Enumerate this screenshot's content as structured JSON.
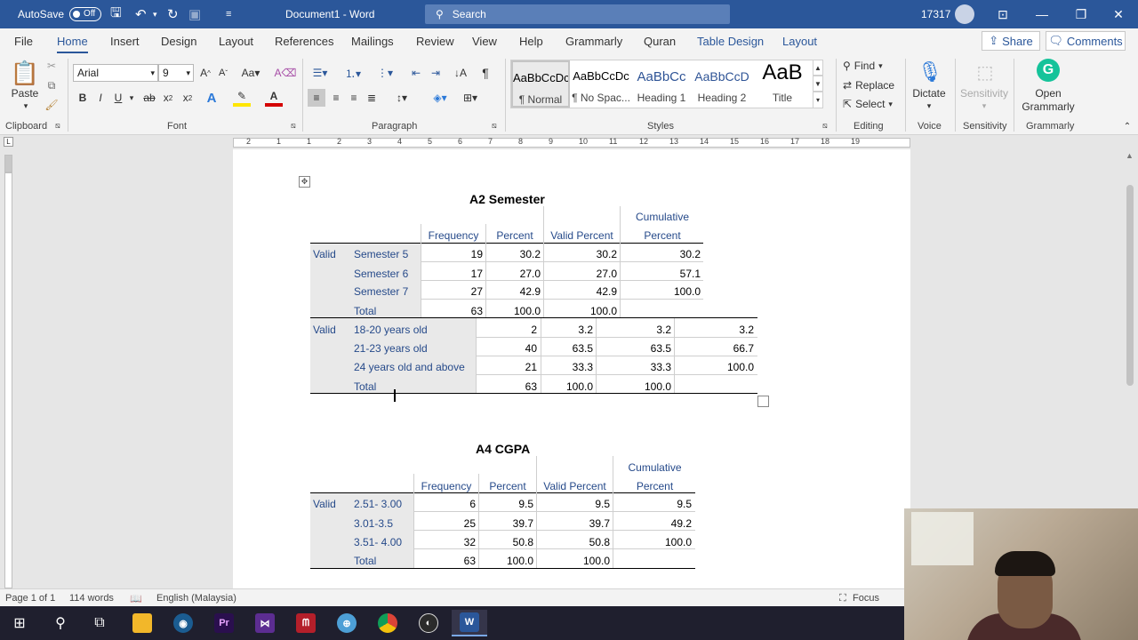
{
  "titlebar": {
    "autosave_label": "AutoSave",
    "autosave_state": "Off",
    "document_title": "Document1  -  Word",
    "search_placeholder": "Search",
    "account_number": "17317"
  },
  "menu": {
    "tabs": [
      "File",
      "Home",
      "Insert",
      "Design",
      "Layout",
      "References",
      "Mailings",
      "Review",
      "View",
      "Help",
      "Grammarly",
      "Quran",
      "Table Design",
      "Layout"
    ],
    "active": "Home",
    "share": "Share",
    "comments": "Comments"
  },
  "ribbon": {
    "clipboard": {
      "paste": "Paste",
      "label": "Clipboard"
    },
    "font": {
      "name": "Arial",
      "size": "9",
      "label": "Font"
    },
    "paragraph": {
      "label": "Paragraph"
    },
    "styles": {
      "label": "Styles",
      "items": [
        {
          "sample": "AaBbCcDc",
          "name": "¶ Normal"
        },
        {
          "sample": "AaBbCcDc",
          "name": "¶ No Spac..."
        },
        {
          "sample": "AaBbCc",
          "name": "Heading 1"
        },
        {
          "sample": "AaBbCcD",
          "name": "Heading 2"
        },
        {
          "sample": "AaB",
          "name": "Title"
        }
      ]
    },
    "editing": {
      "find": "Find",
      "replace": "Replace",
      "select": "Select",
      "label": "Editing"
    },
    "voice": {
      "dictate": "Dictate",
      "label": "Voice"
    },
    "sensitivity": {
      "button": "Sensitivity",
      "label": "Sensitivity"
    },
    "grammarly": {
      "open1": "Open",
      "open2": "Grammarly",
      "label": "Grammarly"
    }
  },
  "ruler_numbers": [
    "2",
    "1",
    "1",
    "2",
    "3",
    "4",
    "5",
    "6",
    "7",
    "8",
    "9",
    "10",
    "11",
    "12",
    "13",
    "14",
    "15",
    "16",
    "17",
    "18",
    "19"
  ],
  "document": {
    "table1": {
      "title": "A2 Semester",
      "headers": {
        "frequency": "Frequency",
        "percent": "Percent",
        "valid_percent": "Valid Percent",
        "cumulative_1": "Cumulative",
        "cumulative_2": "Percent"
      },
      "group_label": "Valid",
      "rows": [
        {
          "label": "Semester 5",
          "frequency": "19",
          "percent": "30.2",
          "valid_percent": "30.2",
          "cumulative": "30.2"
        },
        {
          "label": "Semester 6",
          "frequency": "17",
          "percent": "27.0",
          "valid_percent": "27.0",
          "cumulative": "57.1"
        },
        {
          "label": "Semester 7",
          "frequency": "27",
          "percent": "42.9",
          "valid_percent": "42.9",
          "cumulative": "100.0"
        },
        {
          "label": "Total",
          "frequency": "63",
          "percent": "100.0",
          "valid_percent": "100.0",
          "cumulative": ""
        }
      ]
    },
    "table2": {
      "group_label": "Valid",
      "rows": [
        {
          "label": "18-20 years old",
          "frequency": "2",
          "percent": "3.2",
          "valid_percent": "3.2",
          "cumulative": "3.2"
        },
        {
          "label": "21-23 years old",
          "frequency": "40",
          "percent": "63.5",
          "valid_percent": "63.5",
          "cumulative": "66.7"
        },
        {
          "label": "24 years old and above",
          "frequency": "21",
          "percent": "33.3",
          "valid_percent": "33.3",
          "cumulative": "100.0"
        },
        {
          "label": "Total",
          "frequency": "63",
          "percent": "100.0",
          "valid_percent": "100.0",
          "cumulative": ""
        }
      ]
    },
    "table3": {
      "title": "A4 CGPA",
      "headers": {
        "frequency": "Frequency",
        "percent": "Percent",
        "valid_percent": "Valid Percent",
        "cumulative_1": "Cumulative",
        "cumulative_2": "Percent"
      },
      "group_label": "Valid",
      "rows": [
        {
          "label": "2.51- 3.00",
          "frequency": "6",
          "percent": "9.5",
          "valid_percent": "9.5",
          "cumulative": "9.5"
        },
        {
          "label": "3.01-3.5",
          "frequency": "25",
          "percent": "39.7",
          "valid_percent": "39.7",
          "cumulative": "49.2"
        },
        {
          "label": "3.51- 4.00",
          "frequency": "32",
          "percent": "50.8",
          "valid_percent": "50.8",
          "cumulative": "100.0"
        },
        {
          "label": "Total",
          "frequency": "63",
          "percent": "100.0",
          "valid_percent": "100.0",
          "cumulative": ""
        }
      ]
    }
  },
  "statusbar": {
    "page": "Page 1 of 1",
    "words": "114 words",
    "language": "English (Malaysia)",
    "focus": "Focus"
  },
  "taskbar": {
    "items": [
      {
        "icon": "windows-start-icon"
      },
      {
        "icon": "search-icon"
      },
      {
        "icon": "task-view-icon"
      },
      {
        "icon": "file-explorer-icon"
      },
      {
        "icon": "steam-icon"
      },
      {
        "icon": "premiere-pro-icon",
        "text": "Pr"
      },
      {
        "icon": "visual-studio-icon"
      },
      {
        "icon": "mendeley-icon"
      },
      {
        "icon": "globe-app-icon"
      },
      {
        "icon": "chrome-icon"
      },
      {
        "icon": "obs-icon"
      },
      {
        "icon": "word-icon",
        "text": "W"
      }
    ]
  },
  "colors": {
    "word_blue": "#2b579a",
    "table_label_blue": "#264a8a",
    "row_shade": "#e9e9e9"
  }
}
